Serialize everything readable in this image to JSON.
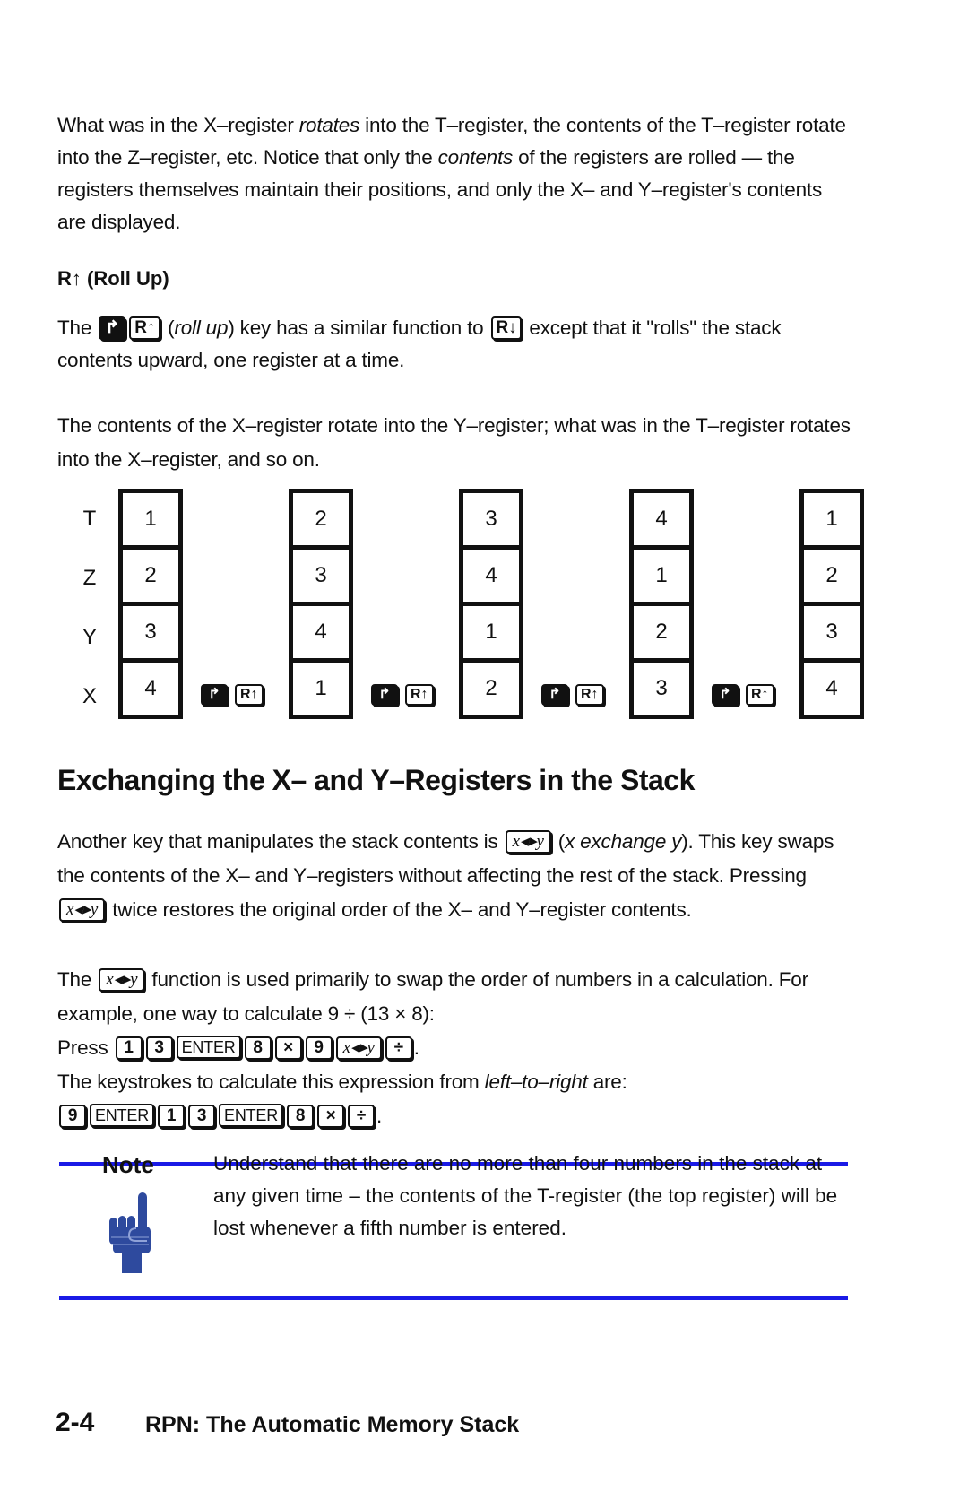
{
  "paragraph1": {
    "a": "What was in the X–register ",
    "a_em": "rotates",
    "b": " into the T–register, the contents of the T–register rotate into the Z–register, etc. Notice that only the ",
    "b_em": "contents",
    "c": " of the registers are rolled — the registers themselves maintain their positions, and only the X– and Y–register's contents are displayed."
  },
  "rollup_heading": "R↑ (Roll Up)",
  "paragraph2": {
    "a": "The",
    "key_shift": "↱",
    "key_rup": "R↑",
    "b_em": "roll up",
    "c": " key has a similar function to ",
    "key_rdown": "R↓",
    "d": " except that it \"rolls\" the stack contents upward, one register at a time."
  },
  "paragraph3": "The contents of the X–register rotate into the Y–register; what was in the T–register rotates into the X–register, and so on.",
  "stack_diagram": {
    "register_labels": [
      "T",
      "Z",
      "Y",
      "X"
    ],
    "columns": [
      [
        "1",
        "2",
        "3",
        "4"
      ],
      [
        "2",
        "3",
        "4",
        "1"
      ],
      [
        "3",
        "4",
        "1",
        "2"
      ],
      [
        "4",
        "1",
        "2",
        "3"
      ],
      [
        "1",
        "2",
        "3",
        "4"
      ]
    ],
    "step_keys": {
      "shift": "↱",
      "rollup": "R↑"
    }
  },
  "section_heading": "Exchanging the X– and Y–Registers in the Stack",
  "paragraph4": {
    "a": "Another key that manipulates the stack contents is ",
    "key": "x◂▸y",
    "b_open": " (",
    "b_em": "x exchange y",
    "c": "). This key swaps the contents of the X– and Y–registers without affecting the rest of the stack. Pressing ",
    "d": " twice restores the original order of the X– and Y–register contents."
  },
  "paragraph5": {
    "a": "The ",
    "key": "x◂▸y",
    "b": " function is used primarily to swap the order of numbers in a calculation. For example, one way to calculate 9 ÷ (13 × 8):",
    "press_label": "Press ",
    "press_keys": [
      "1",
      "3",
      "ENTER",
      "8",
      "×",
      "9",
      "x◂▸y",
      "÷"
    ],
    "period": "."
  },
  "paragraph6": {
    "a": "The keystrokes to calculate this expression from ",
    "em": "left–to–right",
    "b": " are:",
    "keys": [
      "9",
      "ENTER",
      "1",
      "3",
      "ENTER",
      "8",
      "×",
      "÷"
    ],
    "period": "."
  },
  "note": {
    "title": "Note",
    "text": "Understand that there are no more than four numbers in the stack at any given time – the contents of the T-register (the top register) will be lost whenever a fifth number is entered.",
    "icon": "pointing-hand-icon",
    "rule_color": "#1a1ae6",
    "icon_color": "#2e4a9e"
  },
  "footer": {
    "page_number": "2-4",
    "chapter_title": "RPN: The Automatic Memory Stack"
  }
}
